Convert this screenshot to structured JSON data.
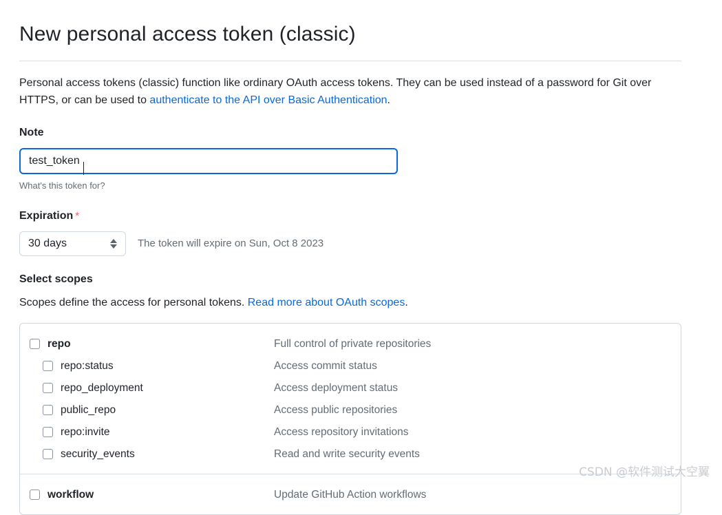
{
  "page_title": "New personal access token (classic)",
  "intro": {
    "text_before": "Personal access tokens (classic) function like ordinary OAuth access tokens. They can be used instead of a password for Git over HTTPS, or can be used to ",
    "link_text": "authenticate to the API over Basic Authentication",
    "text_after": "."
  },
  "note": {
    "label": "Note",
    "value": "test_token",
    "placeholder": "What's this token for?",
    "help": "What's this token for?"
  },
  "expiration": {
    "label": "Expiration",
    "required_marker": "*",
    "selected": "30 days",
    "note": "The token will expire on Sun, Oct 8 2023"
  },
  "scopes": {
    "title": "Select scopes",
    "description_before": "Scopes define the access for personal tokens. ",
    "description_link": "Read more about OAuth scopes",
    "description_after": ".",
    "groups": [
      {
        "parent": {
          "name": "repo",
          "desc": "Full control of private repositories",
          "checked": false
        },
        "children": [
          {
            "name": "repo:status",
            "desc": "Access commit status",
            "checked": false
          },
          {
            "name": "repo_deployment",
            "desc": "Access deployment status",
            "checked": false
          },
          {
            "name": "public_repo",
            "desc": "Access public repositories",
            "checked": false
          },
          {
            "name": "repo:invite",
            "desc": "Access repository invitations",
            "checked": false
          },
          {
            "name": "security_events",
            "desc": "Read and write security events",
            "checked": false
          }
        ]
      },
      {
        "parent": {
          "name": "workflow",
          "desc": "Update GitHub Action workflows",
          "checked": false
        },
        "children": []
      }
    ]
  },
  "watermark": "CSDN @软件测试大空翼",
  "colors": {
    "link": "#0969da",
    "focus_border": "#0969da",
    "required_star": "#f4586a",
    "muted_text": "#636c76",
    "border": "#d0d7de"
  }
}
